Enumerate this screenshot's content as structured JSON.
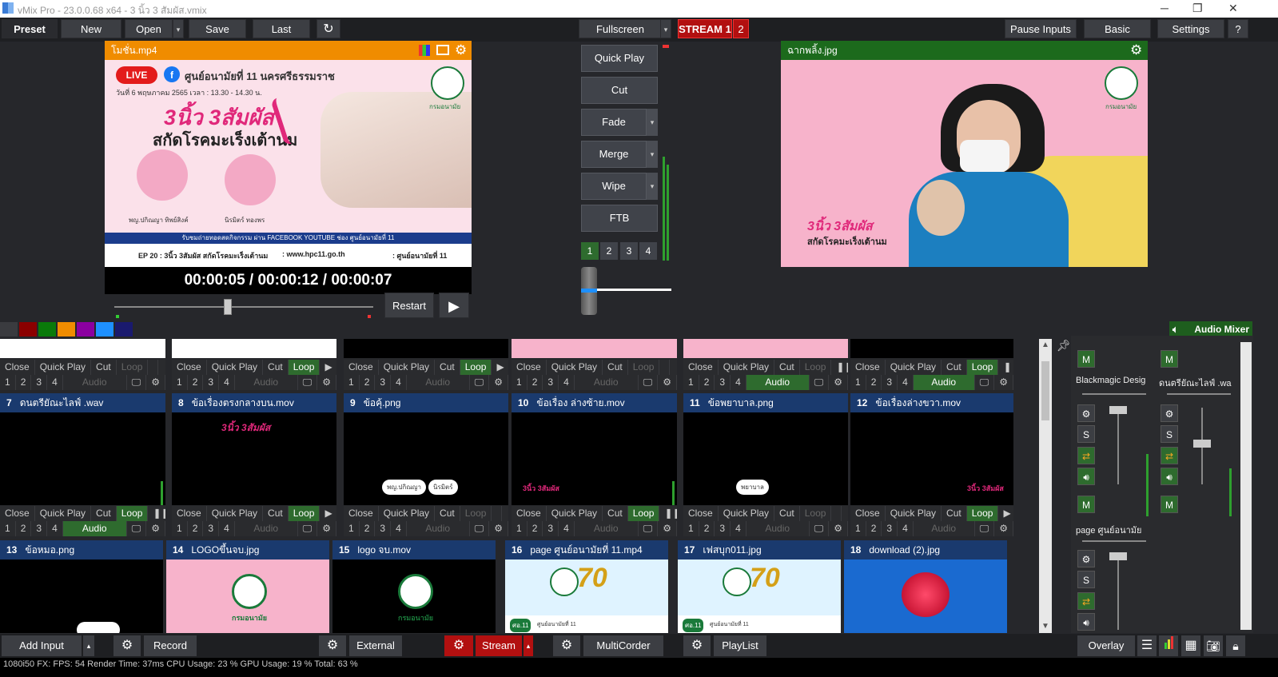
{
  "window": {
    "title": "vMix Pro - 23.0.0.68 x64 - 3 นิ้ว 3 สัมผัส.vmix",
    "minimize": "─",
    "maximize": "❐",
    "close": "✕"
  },
  "toolbar": {
    "preset": "Preset",
    "new": "New",
    "open": "Open",
    "save": "Save",
    "last": "Last",
    "undo_icon": "↻",
    "fullscreen": "Fullscreen",
    "stream_label": "STREAM 1",
    "stream_num": "2",
    "pause_inputs": "Pause Inputs",
    "basic": "Basic",
    "settings": "Settings",
    "help": "?"
  },
  "preview": {
    "title": "โมชั่น.mp4",
    "header_color": "#f08c00",
    "time": "00:00:05  /  00:00:12  /  00:00:07",
    "restart": "Restart",
    "graphic": {
      "live": "LIVE",
      "org": "ศูนย์อนามัยที่ 11 นครศรีธรรมราช",
      "date": "วันที่ 6 พฤษภาคม 2565 เวลา : 13.30 - 14.30 น.",
      "headline1": "3นิ้ว 3สัมผัส",
      "headline2": "สกัดโรคมะเร็งเต้านม",
      "speaker1": "พญ.ปกิณญา ทิพย์สิงค์",
      "speaker2": "นิรมิตร์ ทองพร",
      "strip": "รับชมถ่ายทอดสดกิจกรรม ผ่าน FACEBOOK YOUTUBE ช่อง ศูนย์อนามัยที่ 11",
      "footer_ep": "EP 20 : 3นิ้ว 3สัมผัส สกัดโรคมะเร็งเต้านม",
      "footer_url": ": www.hpc11.go.th",
      "footer_page": ": ศูนย์อนามัยที่ 11",
      "logo_text": "กรมอนามัย"
    }
  },
  "transitions": {
    "quick_play": "Quick Play",
    "cut": "Cut",
    "fade": "Fade",
    "merge": "Merge",
    "wipe": "Wipe",
    "ftb": "FTB",
    "pages": [
      "1",
      "2",
      "3",
      "4"
    ]
  },
  "output": {
    "title": "ฉากพลิ้ง.jpg",
    "header_color": "#1c6a1c",
    "overlay1": "3นิ้ว 3สัมผัส",
    "overlay2": "สกัดโรคมะเร็งเต้านม",
    "logo_text": "กรมอนามัย"
  },
  "color_swatches": [
    "#3a3b3f",
    "#8b0000",
    "#0a7a0a",
    "#f08c00",
    "#8b00a0",
    "#1e90ff",
    "#1a1a6e"
  ],
  "audio_mixer": {
    "label": "Audio Mixer"
  },
  "row_top": [
    {
      "close": "Close",
      "qp": "Quick Play",
      "cut": "Cut",
      "loop": "Loop",
      "loop_on": false,
      "audio_on": false,
      "audio": "Audio"
    },
    {
      "close": "Close",
      "qp": "Quick Play",
      "cut": "Cut",
      "loop": "Loop",
      "loop_on": true,
      "audio_on": false,
      "audio": "Audio"
    },
    {
      "close": "Close",
      "qp": "Quick Play",
      "cut": "Cut",
      "loop": "Loop",
      "loop_on": true,
      "audio_on": false,
      "audio": "Audio"
    },
    {
      "close": "Close",
      "qp": "Quick Play",
      "cut": "Cut",
      "loop": "Loop",
      "loop_on": false,
      "audio_on": false,
      "audio": "Audio"
    },
    {
      "close": "Close",
      "qp": "Quick Play",
      "cut": "Cut",
      "loop": "Loop",
      "loop_on": false,
      "audio_on": true,
      "audio": "Audio"
    },
    {
      "close": "Close",
      "qp": "Quick Play",
      "cut": "Cut",
      "loop": "Loop",
      "loop_on": true,
      "audio_on": true,
      "audio": "Audio"
    }
  ],
  "inputs_row2": [
    {
      "num": "7",
      "name": "ดนตรียัณะไลฟ์ .wav"
    },
    {
      "num": "8",
      "name": "ข้อเรื่องตรงกลางบน.mov"
    },
    {
      "num": "9",
      "name": "ข้อคุ้.png"
    },
    {
      "num": "10",
      "name": "ข้อเรื่อง ล่างซ้าย.mov"
    },
    {
      "num": "11",
      "name": "ข้อพยาบาล.png"
    },
    {
      "num": "12",
      "name": "ข้อเรื่องล่างขวา.mov"
    }
  ],
  "row2_controls": [
    {
      "close": "Close",
      "qp": "Quick Play",
      "cut": "Cut",
      "loop": "Loop",
      "loop_on": true,
      "audio": "Audio",
      "audio_on": true
    },
    {
      "close": "Close",
      "qp": "Quick Play",
      "cut": "Cut",
      "loop": "Loop",
      "loop_on": true,
      "audio": "Audio",
      "audio_on": false
    },
    {
      "close": "Close",
      "qp": "Quick Play",
      "cut": "Cut",
      "loop": "Loop",
      "loop_on": false,
      "audio": "Audio",
      "audio_on": false
    },
    {
      "close": "Close",
      "qp": "Quick Play",
      "cut": "Cut",
      "loop": "Loop",
      "loop_on": true,
      "audio": "Audio",
      "audio_on": false
    },
    {
      "close": "Close",
      "qp": "Quick Play",
      "cut": "Cut",
      "loop": "Loop",
      "loop_on": false,
      "audio": "Audio",
      "audio_on": false
    },
    {
      "close": "Close",
      "qp": "Quick Play",
      "cut": "Cut",
      "loop": "Loop",
      "loop_on": true,
      "audio": "Audio",
      "audio_on": false
    }
  ],
  "row2_overlays": {
    "t8": "3นิ้ว 3สัมผัส",
    "t9a": "พญ.ปกิณญา",
    "t9b": "นิรมิตร์",
    "t10": "3นิ้ว 3สัมผัส",
    "t11": "พยาบาล",
    "t12": "3นิ้ว 3สัมผัส"
  },
  "inputs_row3": [
    {
      "num": "13",
      "name": "ข้อหมอ.png"
    },
    {
      "num": "14",
      "name": "LOGOขึ้นจบ.jpg"
    },
    {
      "num": "15",
      "name": "logo จบ.mov"
    },
    {
      "num": "16",
      "name": "page ศูนย์อนามัยที่ 11.mp4"
    },
    {
      "num": "17",
      "name": "เฟสบุก011.jpg"
    },
    {
      "num": "18",
      "name": "download (2).jpg"
    }
  ],
  "row3_logo_text": "กรมอนามัย",
  "row3_banner_badge": "ศอ.11",
  "row3_banner_text": "ศูนย์อนามัยที่ 11",
  "row3_anniversary": "70",
  "mixer": {
    "ch1_name": "Blackmagic Desig",
    "ch2_name": "ดนตรียัณะไลฟ์ .wa",
    "ch3_name": "page ศูนย์อนามัย",
    "m": "M",
    "s": "S"
  },
  "bottombar": {
    "add_input": "Add Input",
    "record": "Record",
    "external": "External",
    "stream": "Stream",
    "multicorder": "MultiCorder",
    "playlist": "PlayList",
    "overlay": "Overlay"
  },
  "status": {
    "text": "1080i50   FX: FPS: 54  Render Time: 37ms  CPU Usage: 23 %  GPU Usage: 19 %  Total: 63 %"
  }
}
